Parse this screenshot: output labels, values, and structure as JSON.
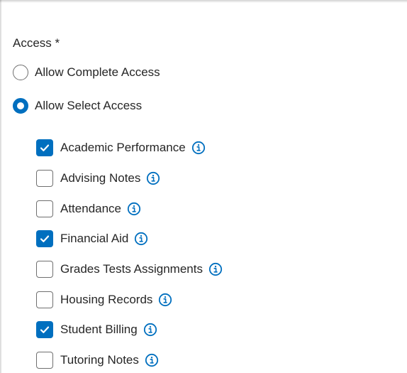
{
  "access": {
    "title": "Access *",
    "options": [
      {
        "label": "Allow Complete Access",
        "selected": false
      },
      {
        "label": "Allow Select Access",
        "selected": true
      }
    ],
    "items": [
      {
        "label": "Academic Performance",
        "checked": true
      },
      {
        "label": "Advising Notes",
        "checked": false
      },
      {
        "label": "Attendance",
        "checked": false
      },
      {
        "label": "Financial Aid",
        "checked": true
      },
      {
        "label": "Grades Tests Assignments",
        "checked": false
      },
      {
        "label": "Housing Records",
        "checked": false
      },
      {
        "label": "Student Billing",
        "checked": true
      },
      {
        "label": "Tutoring Notes",
        "checked": false
      }
    ]
  },
  "icons": {
    "info": "info-circle-icon",
    "check": "checkmark-icon"
  },
  "colors": {
    "accent": "#006fbf",
    "text": "#262626",
    "border": "#6f6f6f"
  }
}
